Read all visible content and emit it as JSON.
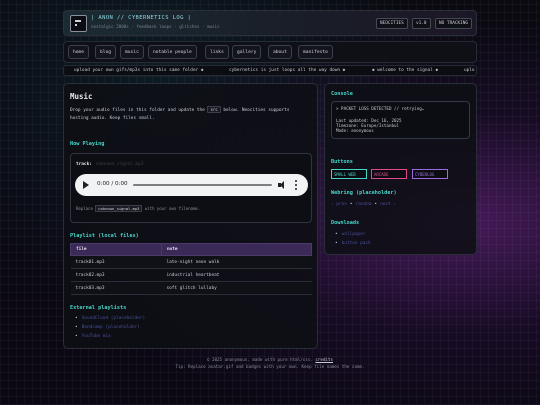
{
  "header": {
    "title": "| ANON // CYBERNETICS LOG |",
    "tagline": "nostalgic 2000s · feedback loops · glitches · music",
    "badges": [
      "NEOCITIES",
      "v1.0",
      "NO TRACKING"
    ]
  },
  "nav": [
    "home",
    "blog",
    "music",
    "notable people",
    "links",
    "gallery",
    "about",
    "manifesto"
  ],
  "ticker": [
    "upload your own gifs/mp3s into this same folder ◆",
    "cybernetics is just loops all the way down ◆",
    "◆ welcome to the signal ◆",
    "uplo"
  ],
  "main": {
    "title": "Music",
    "intro_before": "Drop your audio files in this folder and update the",
    "intro_code": "src",
    "intro_after": "below. Neocities supports hosting audio. Keep files small.",
    "now_playing": {
      "heading": "Now Playing",
      "track_label": "track:",
      "track_name": "unknown_signal.mp3",
      "player_time": "0:00 / 0:00",
      "replace_before": "Replace",
      "replace_code": "unknown_signal.mp3",
      "replace_after": "with your own filename."
    },
    "playlist": {
      "heading": "Playlist (local files)",
      "columns": [
        "file",
        "note"
      ],
      "rows": [
        [
          "track01.mp3",
          "late-night neon walk"
        ],
        [
          "track02.mp3",
          "industrial heartbeat"
        ],
        [
          "track03.mp3",
          "soft glitch lullaby"
        ]
      ]
    },
    "external": {
      "heading": "External playlists",
      "links": [
        "SoundCloud (placeholder)",
        "Bandcamp (placeholder)",
        "YouTube mix"
      ]
    }
  },
  "sidebar": {
    "console_heading": "Console",
    "console_lines": [
      "> PACKET LOSS DETECTED // retrying…",
      "Last updated: Dec 16, 2025",
      "Timezone: Europe/Istanbul",
      "Mode: anonymous"
    ],
    "buttons_heading": "Buttons",
    "buttons": [
      {
        "label": "SMALL WEB",
        "color": "#45d6c8"
      },
      {
        "label": "ARCADE",
        "color": "#e04a8a"
      },
      {
        "label": "CYBERLOG",
        "color": "#9a6ae0"
      }
    ],
    "webring_heading": "Webring (placeholder)",
    "webring": [
      "‹ prev",
      "random",
      "next ›"
    ],
    "downloads_heading": "Downloads",
    "downloads": [
      "wallpaper",
      "button pack"
    ]
  },
  "footer": {
    "line1_before": "© 2025 anonymous. made with pure html/css.",
    "credits": "credits",
    "line2": "Tip: Replace avatar.gif and badges with your own. Keep file names the same."
  },
  "colors": {
    "accent": "#45d6c8",
    "header_accent": "#8fd9e6",
    "table_header": "#3b2a58"
  }
}
